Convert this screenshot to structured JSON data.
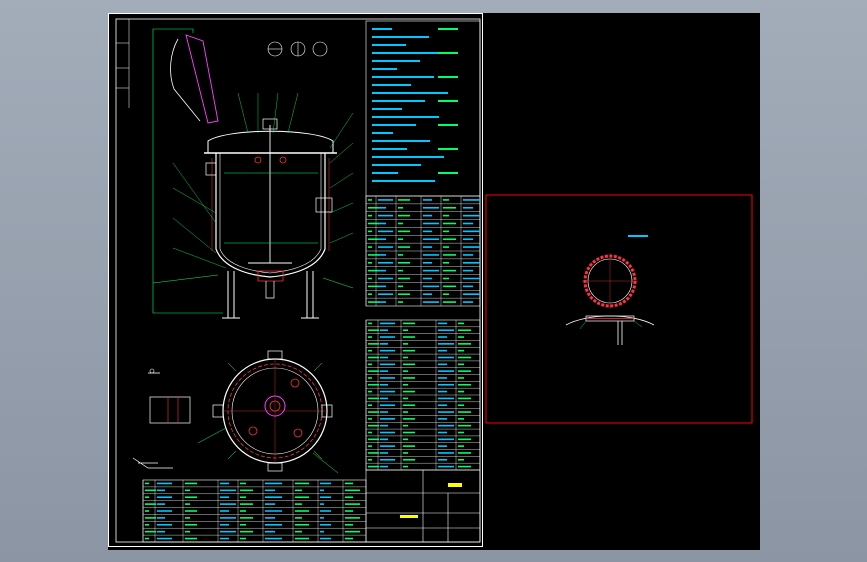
{
  "viewport": {
    "title": "",
    "colors": {
      "background": "#8f98a6",
      "model_space": "#000000",
      "border": "#ffffff",
      "dimension": "#00ff66",
      "geometry": "#ffffff",
      "hidden": "#ff3040",
      "annotation": "#00c8ff",
      "accent": "#ff40ff",
      "detail_frame": "#ff0000",
      "text": "#ffff00"
    }
  },
  "drawing": {
    "main_sheet": {
      "name": "vessel-assembly-sheet"
    },
    "detail_sheet": {
      "name": "manhole-detail-sheet",
      "title_text": ""
    },
    "tables": {
      "tech_requirements_rows": 20,
      "nozzle_table_rows": 14,
      "parts_list_rows": 22,
      "bottom_bom_rows": 9
    }
  }
}
